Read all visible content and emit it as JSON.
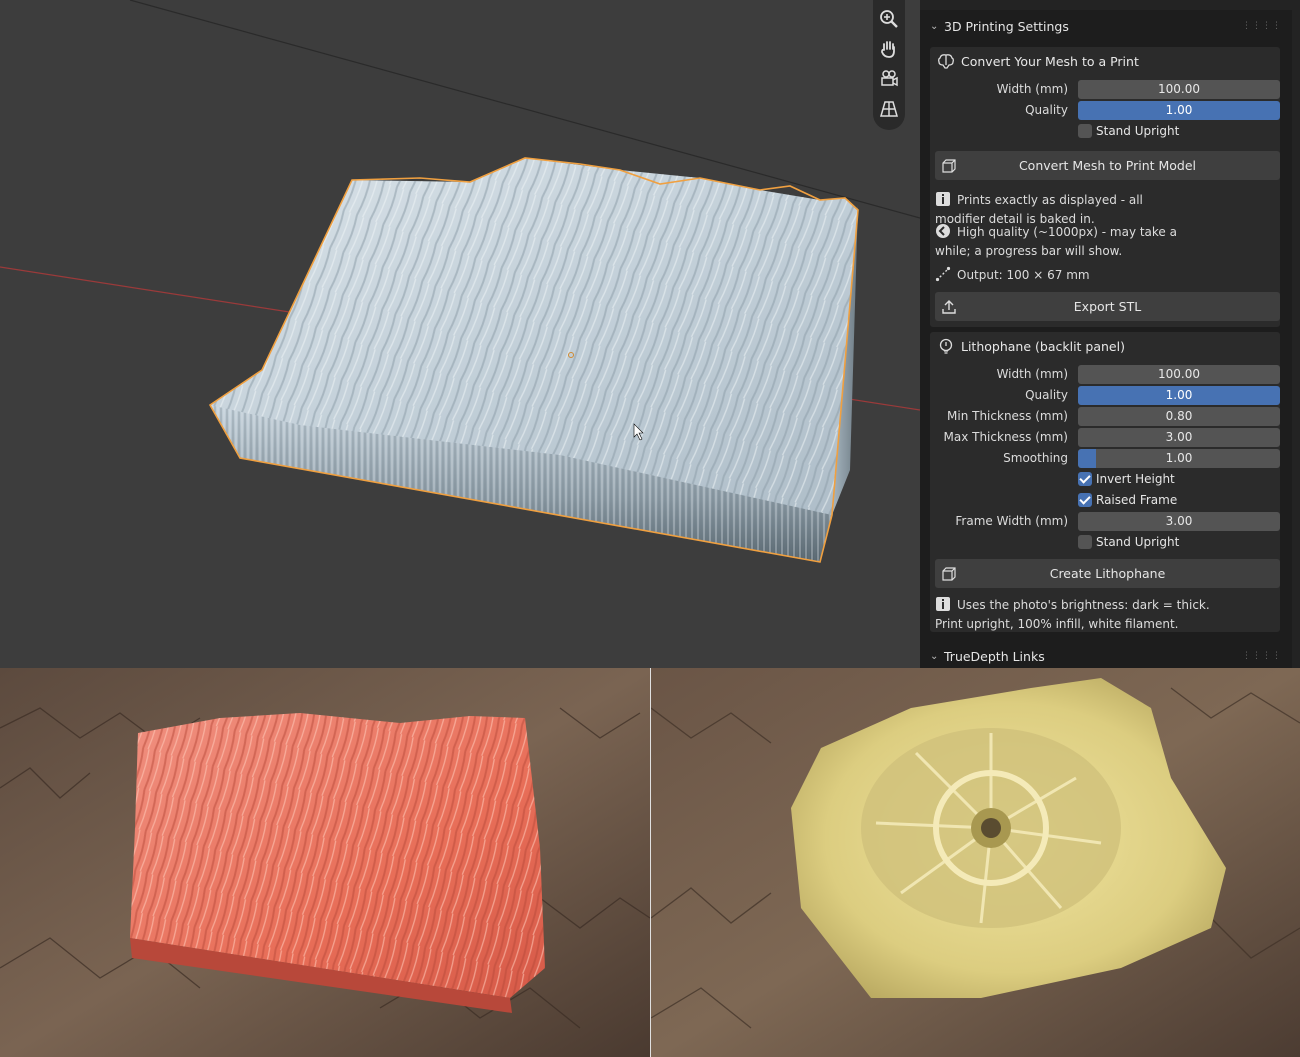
{
  "panel": {
    "printing_header": "3D Printing Settings",
    "convert": {
      "title": "Convert Your Mesh to a Print",
      "width_label": "Width (mm)",
      "width_value": "100.00",
      "quality_label": "Quality",
      "quality_value": "1.00",
      "stand_upright": "Stand Upright",
      "button": "Convert Mesh to Print Model",
      "info1_line1": "Prints exactly as displayed - all",
      "info1_line2": "modifier detail is baked in.",
      "info2_line1": "High quality (~1000px) - may take a",
      "info2_line2": "while; a progress bar will show.",
      "output": "Output: 100 × 67 mm",
      "export_button": "Export STL"
    },
    "lithophane": {
      "title": "Lithophane (backlit panel)",
      "width_label": "Width (mm)",
      "width_value": "100.00",
      "quality_label": "Quality",
      "quality_value": "1.00",
      "min_label": "Min Thickness (mm)",
      "min_value": "0.80",
      "max_label": "Max Thickness (mm)",
      "max_value": "3.00",
      "smoothing_label": "Smoothing",
      "smoothing_value": "1.00",
      "smoothing_fraction": 0.09,
      "invert_height": "Invert Height",
      "raised_frame": "Raised Frame",
      "frame_width_label": "Frame Width (mm)",
      "frame_width_value": "3.00",
      "stand_upright": "Stand Upright",
      "button": "Create Lithophane",
      "info_line1": "Uses the photo's brightness: dark = thick.",
      "info_line2": "Print upright, 100% infill, white filament."
    },
    "truedepth_header": "TrueDepth Links"
  },
  "icons": {
    "zoom": "zoom-icon",
    "hand": "hand-pan-icon",
    "camera": "camera-view-icon",
    "grid": "perspective-grid-icon"
  },
  "colors": {
    "accent": "#4772b3",
    "selection_outline": "#f0a040",
    "print_red": "#e8705c",
    "print_yellow": "#e6d688"
  }
}
